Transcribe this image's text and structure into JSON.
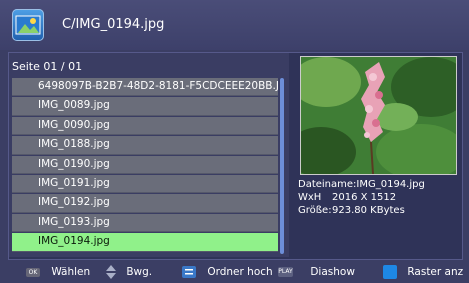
{
  "header": {
    "path": "C/IMG_0194.jpg",
    "app_icon": "photo-viewer-icon"
  },
  "list": {
    "page": "Seite  01 / 01",
    "items": [
      "6498097B-B2B7-48D2-8181-F5CDCEEE20BB.J",
      "IMG_0089.jpg",
      "IMG_0090.jpg",
      "IMG_0188.jpg",
      "IMG_0190.jpg",
      "IMG_0191.jpg",
      "IMG_0192.jpg",
      "IMG_0193.jpg",
      "IMG_0194.jpg"
    ],
    "selected": "IMG_0194.jpg"
  },
  "details": {
    "filename": "Dateiname:IMG_0194.jpg",
    "size_label": "WxH",
    "size_value": "2016 X 1512",
    "bytes_label": "Größe:",
    "bytes_value": "923.80 KBytes"
  },
  "footer": {
    "ok_key": "OK",
    "select": "Wählen",
    "move": "Bwg.",
    "folder_up": "Ordner hoch",
    "play_key": "PLAY",
    "slideshow": "Diashow",
    "grid": "Raster anz"
  },
  "colors": {
    "selected_row": "#90f18a",
    "grid_key": "#1e88e5"
  }
}
